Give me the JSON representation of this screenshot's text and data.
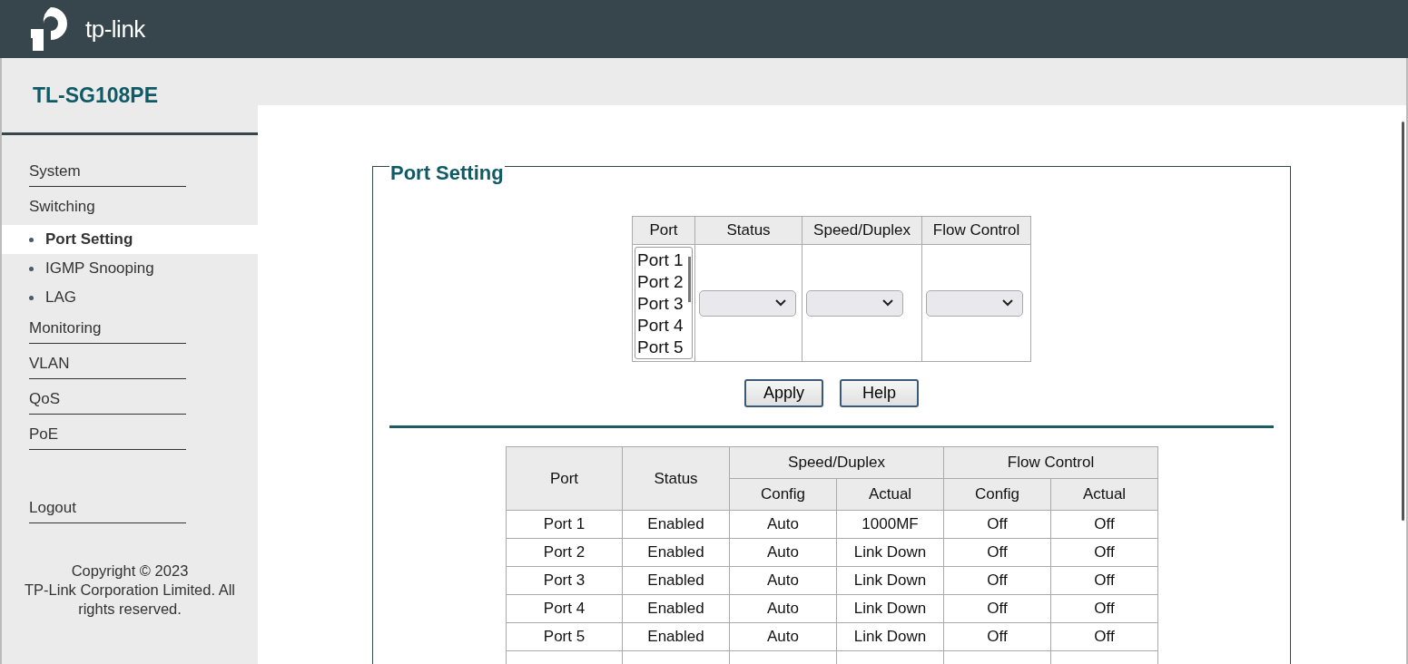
{
  "header": {
    "logo_text": "tp-link"
  },
  "sidebar": {
    "model": "TL-SG108PE",
    "items": [
      {
        "label": "System",
        "expanded": false
      },
      {
        "label": "Switching",
        "expanded": true,
        "children": [
          {
            "label": "Port Setting",
            "selected": true
          },
          {
            "label": "IGMP Snooping",
            "selected": false
          },
          {
            "label": "LAG",
            "selected": false
          }
        ]
      },
      {
        "label": "Monitoring",
        "expanded": false
      },
      {
        "label": "VLAN",
        "expanded": false
      },
      {
        "label": "QoS",
        "expanded": false
      },
      {
        "label": "PoE",
        "expanded": false
      }
    ],
    "logout": "Logout",
    "copyright": "Copyright © 2023\nTP-Link Corporation Limited. All rights reserved."
  },
  "port_setting": {
    "legend": "Port Setting",
    "columns": [
      "Port",
      "Status",
      "Speed/Duplex",
      "Flow Control"
    ],
    "port_list": [
      "Port 1",
      "Port 2",
      "Port 3",
      "Port 4",
      "Port 5"
    ],
    "buttons": [
      "Apply",
      "Help"
    ]
  },
  "table": {
    "header_rows": [
      [
        {
          "label": "Port",
          "rowspan": 2
        },
        {
          "label": "Status",
          "rowspan": 2
        },
        {
          "label": "Speed/Duplex",
          "colspan": 2
        },
        {
          "label": "Flow Control",
          "colspan": 2
        }
      ],
      [
        {
          "label": "Config"
        },
        {
          "label": "Actual"
        },
        {
          "label": "Config"
        },
        {
          "label": "Actual"
        }
      ]
    ],
    "rows": [
      [
        "Port 1",
        "Enabled",
        "Auto",
        "1000MF",
        "Off",
        "Off"
      ],
      [
        "Port 2",
        "Enabled",
        "Auto",
        "Link Down",
        "Off",
        "Off"
      ],
      [
        "Port 3",
        "Enabled",
        "Auto",
        "Link Down",
        "Off",
        "Off"
      ],
      [
        "Port 4",
        "Enabled",
        "Auto",
        "Link Down",
        "Off",
        "Off"
      ],
      [
        "Port 5",
        "Enabled",
        "Auto",
        "Link Down",
        "Off",
        "Off"
      ]
    ]
  }
}
